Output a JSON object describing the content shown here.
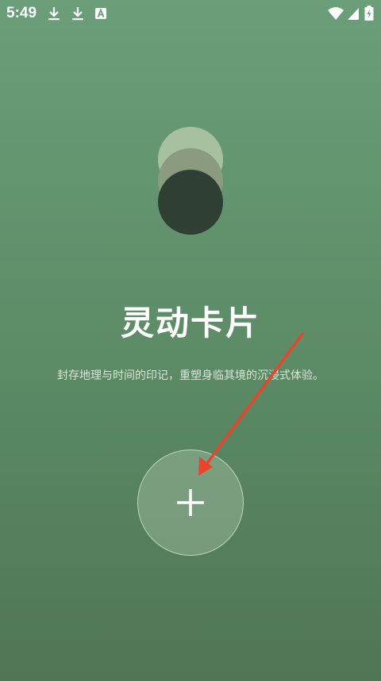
{
  "status_bar": {
    "time": "5:49",
    "left_icons": [
      "download-icon",
      "download-icon",
      "font-icon"
    ],
    "right_icons": [
      "wifi-icon",
      "signal-icon",
      "battery-charging-icon"
    ]
  },
  "hero": {
    "title": "灵动卡片",
    "subtitle": "封存地理与时间的印记，重塑身临其境的沉浸式体验。"
  },
  "actions": {
    "add_icon": "plus-icon"
  },
  "colors": {
    "background_top": "#6a9f79",
    "background_bottom": "#4f7656",
    "circle_light": "#a7c19f",
    "circle_mid": "#8a9b7f",
    "circle_dark": "#2f3f33",
    "annotation_arrow": "#e8452c"
  }
}
